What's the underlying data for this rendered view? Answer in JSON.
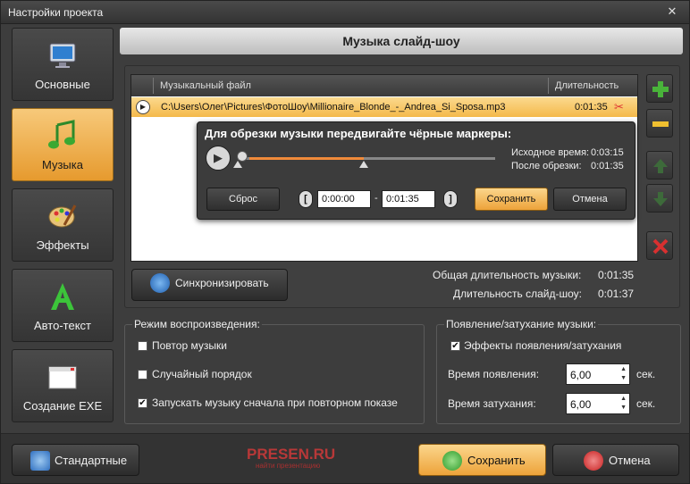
{
  "window": {
    "title": "Настройки проекта",
    "close": "✕"
  },
  "nav": [
    {
      "label": "Основные"
    },
    {
      "label": "Музыка"
    },
    {
      "label": "Эффекты"
    },
    {
      "label": "Авто-текст"
    },
    {
      "label": "Создание EXE"
    }
  ],
  "header": {
    "title": "Музыка слайд-шоу"
  },
  "list": {
    "col_file": "Музыкальный файл",
    "col_duration": "Длительность",
    "rows": [
      {
        "path": "C:\\Users\\Олег\\Pictures\\ФотоШоу\\Millionaire_Blonde_-_Andrea_Si_Sposa.mp3",
        "duration": "0:01:35"
      }
    ]
  },
  "trim": {
    "heading": "Для обрезки музыки передвигайте чёрные маркеры:",
    "source_label": "Исходное время:",
    "source_value": "0:03:15",
    "after_label": "После обрезки:",
    "after_value": "0:01:35",
    "reset": "Сброс",
    "start": "0:00:00",
    "dash": "-",
    "end": "0:01:35",
    "save": "Сохранить",
    "cancel": "Отмена",
    "bracket_left": "[",
    "bracket_right": "]",
    "progress_fraction": 0.49
  },
  "sync_button": "Синхронизировать",
  "summary": {
    "music_label": "Общая длительность музыки:",
    "music_value": "0:01:35",
    "slideshow_label": "Длительность слайд-шоу:",
    "slideshow_value": "0:01:37"
  },
  "playback": {
    "legend": "Режим воспроизведения:",
    "repeat": {
      "label": "Повтор музыки",
      "checked": false
    },
    "random": {
      "label": "Случайный порядок",
      "checked": false
    },
    "restart": {
      "label": "Запускать музыку сначала при повторном показе",
      "checked": true
    }
  },
  "fade": {
    "legend": "Появление/затухание музыки:",
    "effects": {
      "label": "Эффекты появления/затухания",
      "checked": true
    },
    "fade_in_label": "Время появления:",
    "fade_in_value": "6,00",
    "fade_out_label": "Время затухания:",
    "fade_out_value": "6,00",
    "unit": "сек."
  },
  "bottom": {
    "standard": "Стандартные",
    "save": "Сохранить",
    "cancel": "Отмена",
    "logo": "PRESEN.RU",
    "logo_sub": "найти презентацию"
  },
  "colors": {
    "accent": "#f4b94a",
    "fill": "#f08a3a",
    "add": "#49b33a",
    "delete": "#d83030"
  }
}
